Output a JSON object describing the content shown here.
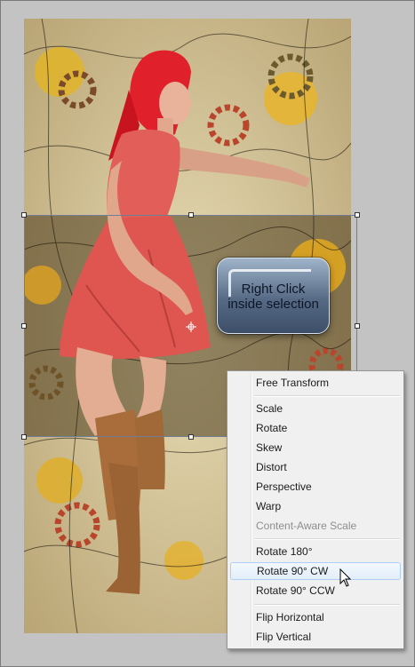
{
  "hint": {
    "line1": "Right Click",
    "line2": "inside selection"
  },
  "context_menu": {
    "items": [
      {
        "label": "Free Transform",
        "enabled": true
      },
      {
        "label": "Scale",
        "enabled": true
      },
      {
        "label": "Rotate",
        "enabled": true
      },
      {
        "label": "Skew",
        "enabled": true
      },
      {
        "label": "Distort",
        "enabled": true
      },
      {
        "label": "Perspective",
        "enabled": true
      },
      {
        "label": "Warp",
        "enabled": true
      },
      {
        "label": "Content-Aware Scale",
        "enabled": false
      },
      {
        "label": "Rotate 180°",
        "enabled": true
      },
      {
        "label": "Rotate 90° CW",
        "enabled": true,
        "highlighted": true
      },
      {
        "label": "Rotate 90° CCW",
        "enabled": true
      },
      {
        "label": "Flip Horizontal",
        "enabled": true
      },
      {
        "label": "Flip Vertical",
        "enabled": true
      }
    ]
  },
  "colors": {
    "frame": "#c3c3c3",
    "menu_background": "#f0f0f0",
    "menu_highlight": "#e3eef9",
    "hint_bubble": "#566a85",
    "hair": "#e0202a",
    "dress": "#e2605a",
    "gear": "#b8452c"
  },
  "icons": [
    "crosshair-icon",
    "arrow-cursor-icon"
  ]
}
